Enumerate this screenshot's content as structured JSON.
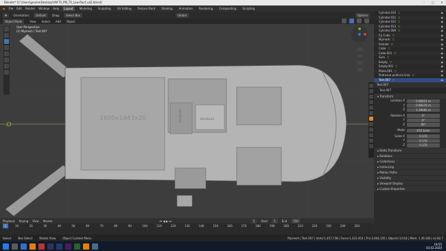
{
  "window": {
    "title": "Blender* [C:\\Users\\gnome\\Desktop\\VW-T5_PM_T5_Low-Roof_v42.blend]"
  },
  "menu": [
    "File",
    "Edit",
    "Render",
    "Window",
    "Help"
  ],
  "workspaces": [
    "Layout",
    "Modeling",
    "Sculpting",
    "UV Editing",
    "Texture Paint",
    "Shading",
    "Animation",
    "Rendering",
    "Compositing",
    "Scripting"
  ],
  "scene": {
    "label": "Scene",
    "view_layer": "View Layer"
  },
  "tool_header": {
    "orientation_label": "Orientation:",
    "orientation": "Default",
    "drag_label": "Drag:",
    "drag": "Select Box",
    "transform": "Global",
    "options": "Options"
  },
  "viewport_header": {
    "mode": "Object Mode",
    "view": "View",
    "select": "Select",
    "add": "Add",
    "object": "Object"
  },
  "overlay_text": {
    "perspective": "User Perspective",
    "collection": "(1) Mymesh | Text.007"
  },
  "model_labels": {
    "bed": "1600x1443x20",
    "cabinet": "80x40x20",
    "small_box": "50x40x40"
  },
  "outliner": [
    {
      "name": "Cylinder.010",
      "sel": false
    },
    {
      "name": "Cylinder.011",
      "sel": false
    },
    {
      "name": "Cylinder.012",
      "sel": false
    },
    {
      "name": "Cylinder.013",
      "sel": false
    },
    {
      "name": "Cylinder.009",
      "sel": false
    },
    {
      "name": "Cy Cube",
      "sel": false
    },
    {
      "name": "Mymesh",
      "sel": false
    },
    {
      "name": "Female",
      "sel": false
    },
    {
      "name": "Cube",
      "sel": false
    },
    {
      "name": "Cube.001",
      "sel": false
    },
    {
      "name": "Sum",
      "sel": false
    },
    {
      "name": "Empty",
      "sel": false
    },
    {
      "name": "Empty.001",
      "sel": false
    },
    {
      "name": "Plane.001",
      "sel": false
    },
    {
      "name": "Podrozna podlaria linia",
      "sel": false
    },
    {
      "name": "Text.007",
      "sel": true
    }
  ],
  "properties": {
    "object_name": "Text.007",
    "sub_name": "Text.007",
    "transform_label": "Transform",
    "location_label": "Location X",
    "location": [
      "0.80021 m",
      "0.68235 m",
      "1.39085 m"
    ],
    "rotation_label": "Rotation X",
    "rotation": [
      "0°",
      "0°",
      "90°"
    ],
    "mode_label": "Mode",
    "mode": "XYZ Euler",
    "scale_label": "Scale X",
    "scale": [
      "0.176",
      "0.176",
      "0.176"
    ],
    "sections": [
      "Delta Transform",
      "Relations",
      "Collections",
      "Instancing",
      "Motion Paths",
      "Visibility",
      "Viewport Display",
      "Custom Properties"
    ]
  },
  "timeline": {
    "menu": [
      "Playback",
      "Keying",
      "View",
      "Marker"
    ],
    "frame": "1",
    "start_label": "Start",
    "start": "1",
    "end_label": "End",
    "end": "250",
    "ticks": [
      "10",
      "20",
      "30",
      "40",
      "50",
      "60",
      "70",
      "80",
      "90",
      "100",
      "110",
      "120",
      "130",
      "140",
      "150",
      "160",
      "170",
      "180",
      "190",
      "200",
      "210",
      "220",
      "230",
      "240",
      "250"
    ]
  },
  "statusbar": {
    "select": "Select",
    "box_select": "Box Select",
    "rotate_view": "Rotate View",
    "context_menu": "Object Context Menu",
    "stats": "Mymesh | Text.007 | Verts:1,457,738 | Faces:1,322,454 | Tris:2,604,105 | Objects:1/118 | Mem: 1.36 GiB | v2.82.7"
  },
  "taskbar": {
    "time": "19:55",
    "date": "03.02.2020"
  },
  "colors": {
    "accent": "#4772b3",
    "header": "#303030",
    "viewport": "#3d3d3d",
    "outliner_sel": "#334d80"
  }
}
